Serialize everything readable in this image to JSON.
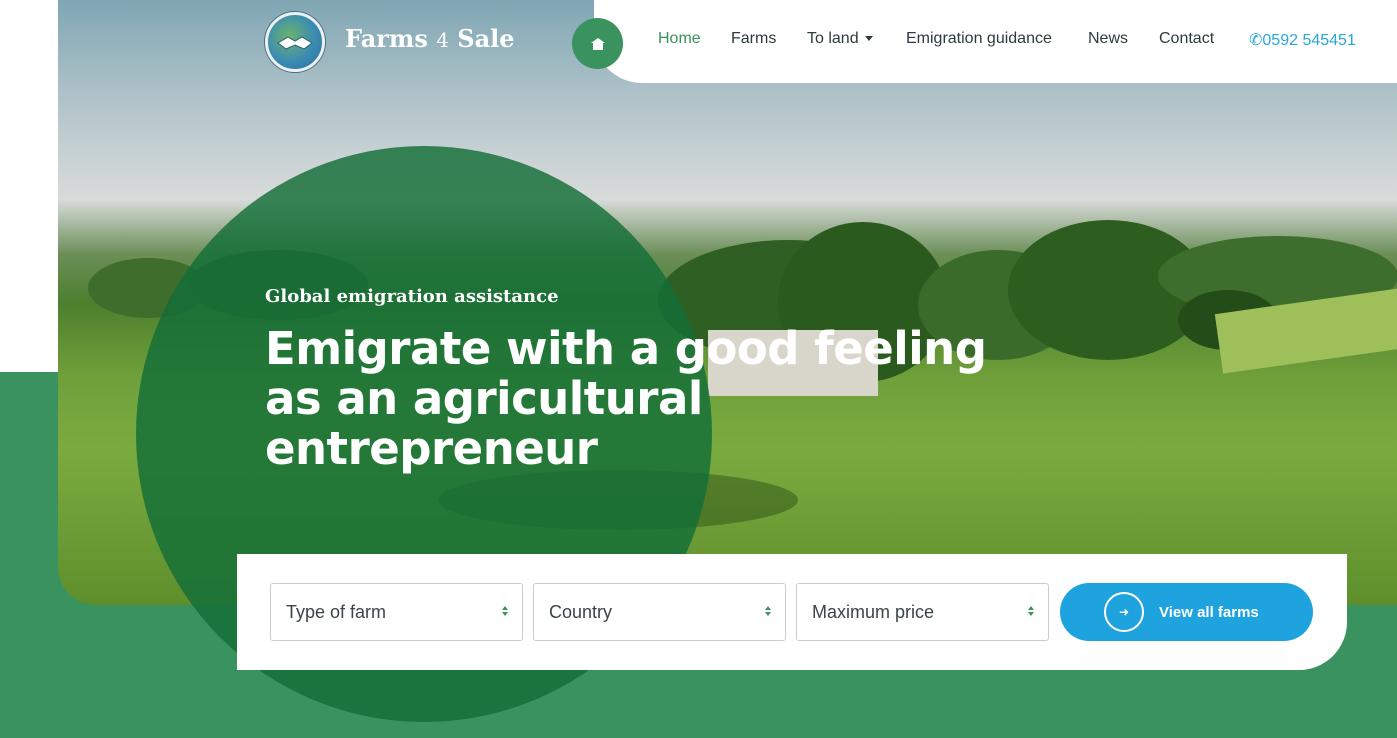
{
  "brand": {
    "name_prefix": "Farms ",
    "name_number": "4",
    "name_suffix": " Sale"
  },
  "nav": {
    "items": [
      "Home",
      "Farms",
      "To land",
      "Emigration guidance",
      "News",
      "Contact"
    ],
    "phone": "0592 545451"
  },
  "hero": {
    "tagline": "Global emigration assistance",
    "headline": "Emigrate with a good feeling as an agricultural entrepreneur"
  },
  "search": {
    "type_of_farm": "Type of farm",
    "country": "Country",
    "max_price": "Maximum price",
    "cta_label": "View all farms"
  },
  "colors": {
    "brand_green": "#3a935e",
    "accent_blue": "#1fa3df",
    "phone_blue": "#27a7d8"
  },
  "icons": {
    "home": "home-icon",
    "phone": "phone-icon",
    "cta": "arrow-right-icon",
    "logo": "handshake-globe-icon"
  }
}
